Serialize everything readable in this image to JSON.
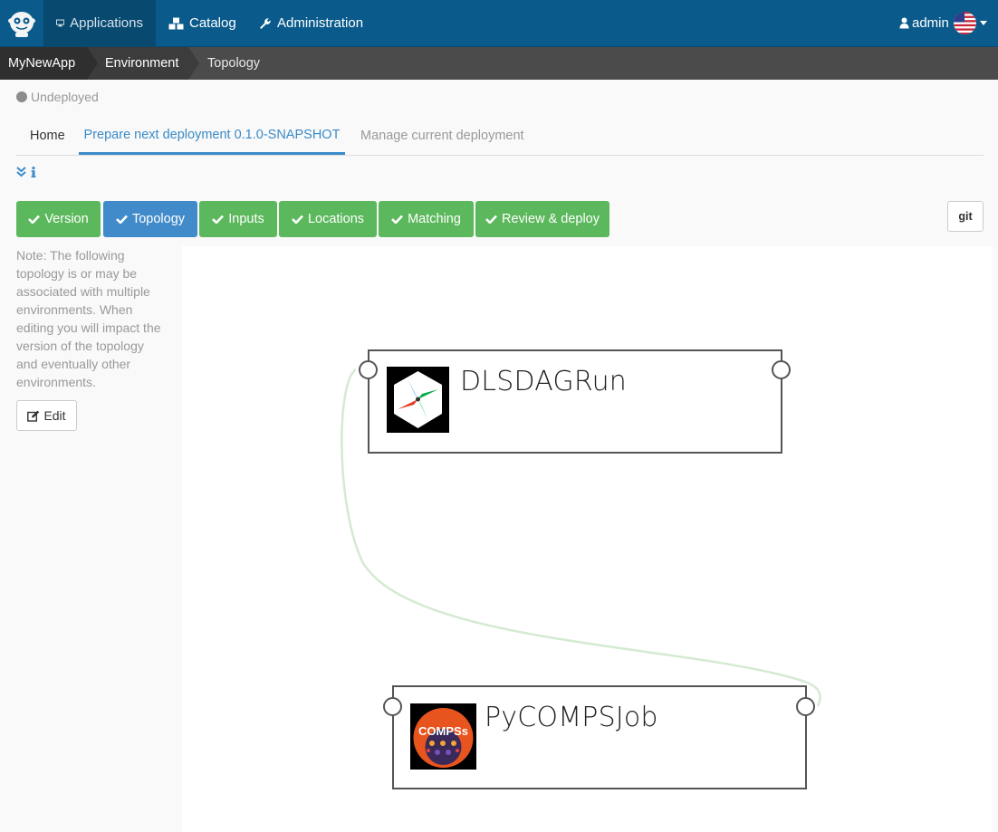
{
  "navbar": {
    "applications": "Applications",
    "catalog": "Catalog",
    "administration": "Administration",
    "user": "admin",
    "language_flag": "us-flag-icon"
  },
  "breadcrumb": [
    "MyNewApp",
    "Environment",
    "Topology"
  ],
  "status": "Undeployed",
  "tabs": {
    "home": "Home",
    "prepare": "Prepare next deployment 0.1.0-SNAPSHOT",
    "manage": "Manage current deployment"
  },
  "steps": [
    "Version",
    "Topology",
    "Inputs",
    "Locations",
    "Matching",
    "Review & deploy"
  ],
  "git_label": "git",
  "note": "Note: The following topology is or may be associated with multiple environments. When editing you will impact the version of the topology and eventually other environments.",
  "edit_label": "Edit",
  "topology": {
    "nodes": [
      {
        "name": "DLSDAGRun",
        "icon": "airflow-pinwheel-icon"
      },
      {
        "name": "PyCOMPSJob",
        "icon": "compss-logo-icon",
        "logo_text": "COMPSs"
      }
    ]
  },
  "colors": {
    "navbar": "#0a5b8c",
    "success": "#5cb85c",
    "primary": "#428bca",
    "link": "#3a8bc8",
    "relationship": "#d5ead2"
  }
}
